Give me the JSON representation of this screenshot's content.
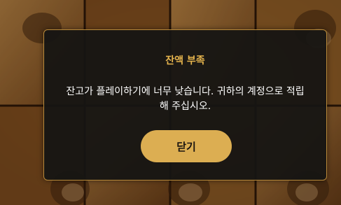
{
  "modal": {
    "title": "잔액 부족",
    "message": "잔고가 플레이하기에 너무 낮습니다. 귀하의 계정으로 적립해 주십시오.",
    "close_label": "닫기"
  },
  "colors": {
    "accent": "#dcae52",
    "title": "#e7b54e",
    "modal_bg": "#161513",
    "modal_border": "#b98a3a"
  }
}
